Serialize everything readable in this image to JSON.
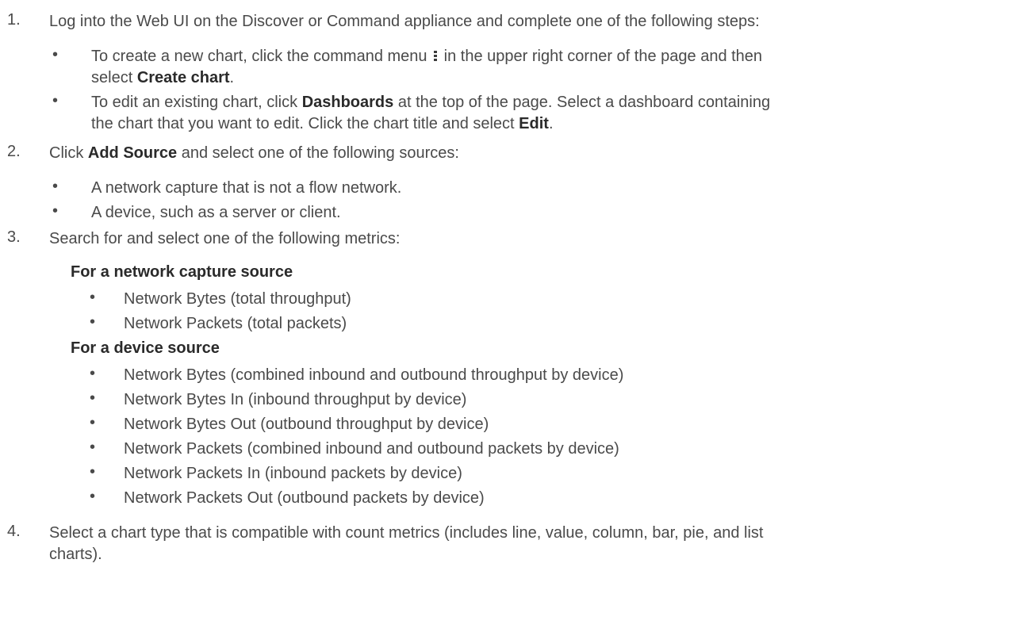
{
  "steps": [
    {
      "num": "1.",
      "text": "Log into the Web UI on the Discover or Command appliance and complete one of the following steps:",
      "bullets": [
        {
          "pre": "To create a new chart, click the command menu",
          "mid": "in the upper right corner of the page and then",
          "line2_pre": "select ",
          "bold": "Create chart",
          "post": "."
        },
        {
          "pre": "To edit an existing chart, click ",
          "bold": "Dashboards",
          "mid": " at the top of the page. Select a dashboard containing",
          "line2_pre": "the chart that you want to edit. Click the chart title and select ",
          "bold2": "Edit",
          "post": "."
        }
      ]
    },
    {
      "num": "2.",
      "pre": "Click ",
      "bold": "Add Source",
      "post": " and select one of the following sources:",
      "bullets": [
        "A network capture that is not a flow network.",
        "A device, such as a server or client."
      ]
    },
    {
      "num": "3.",
      "text": "Search for and select one of the following metrics:",
      "groups": [
        {
          "heading": "For a network capture source",
          "items": [
            "Network Bytes (total throughput)",
            "Network Packets (total packets)"
          ]
        },
        {
          "heading": "For a device source",
          "items": [
            "Network Bytes (combined inbound and outbound throughput by device)",
            "Network Bytes In (inbound throughput by device)",
            "Network Bytes Out (outbound throughput by device)",
            "Network Packets (combined inbound and outbound packets by device)",
            "Network Packets In (inbound packets by device)",
            "Network Packets Out (outbound packets by device)"
          ]
        }
      ]
    },
    {
      "num": "4.",
      "line1": "Select a chart type that is compatible with count metrics (includes line, value, column, bar, pie, and list",
      "line2": "charts)."
    }
  ],
  "bullet_glyph": "•",
  "icons": {
    "command_menu": "command-menu-icon"
  }
}
